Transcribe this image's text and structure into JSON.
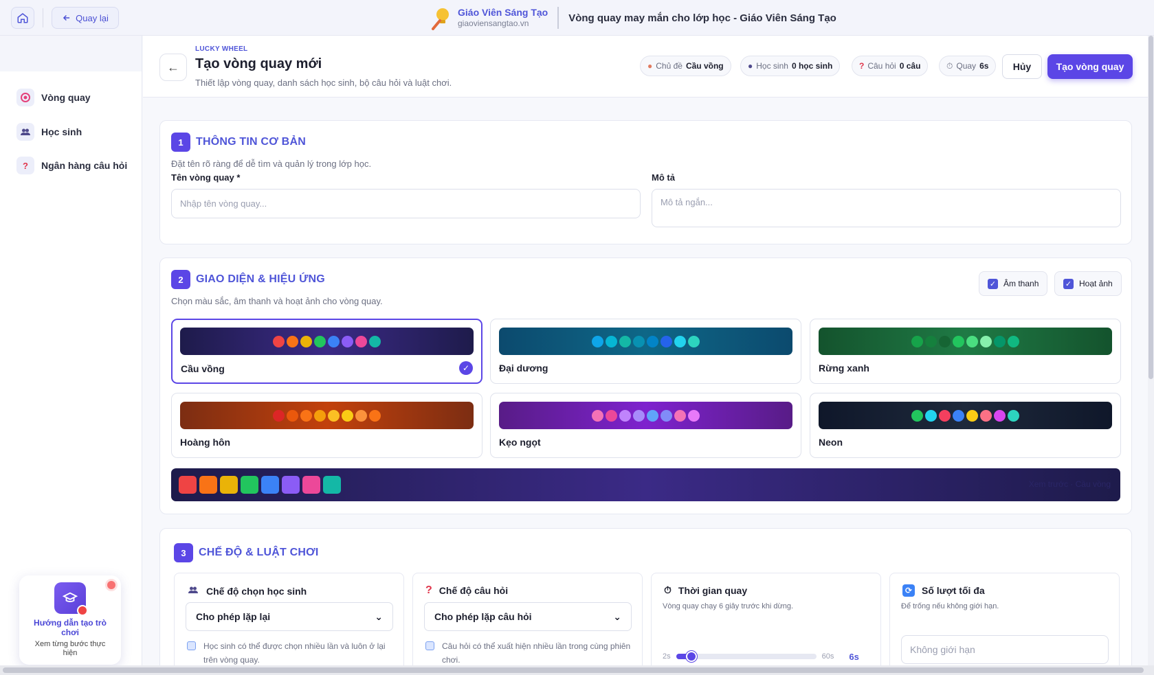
{
  "topbar": {
    "back_label": "Quay lại",
    "brand_name": "Giáo Viên Sáng Tạo",
    "brand_url": "giaoviensangtao.vn",
    "page_title": "Vòng quay may mắn cho lớp học - Giáo Viên Sáng Tạo"
  },
  "sidebar": {
    "items": [
      {
        "label": "Vòng quay",
        "icon": "target-icon"
      },
      {
        "label": "Học sinh",
        "icon": "users-icon"
      },
      {
        "label": "Ngân hàng câu hỏi",
        "icon": "question-icon"
      }
    ]
  },
  "guide": {
    "title": "Hướng dẫn tạo trò chơi",
    "subtitle": "Xem từng bước thực hiện"
  },
  "header": {
    "kicker": "LUCKY WHEEL",
    "title": "Tạo vòng quay mới",
    "subtitle": "Thiết lập vòng quay, danh sách học sinh, bộ câu hỏi và luật chơi.",
    "chips": [
      {
        "label": "Chủ đề",
        "value": "Cầu vồng"
      },
      {
        "label": "Học sinh",
        "value": "0 học sinh"
      },
      {
        "label": "Câu hỏi",
        "value": "0 câu"
      },
      {
        "label": "Quay",
        "value": "6s"
      }
    ],
    "cancel_label": "Hủy",
    "create_label": "Tạo vòng quay"
  },
  "section1": {
    "number": "1",
    "title": "THÔNG TIN CƠ BẢN",
    "desc": "Đặt tên rõ ràng để dễ tìm và quản lý trong lớp học.",
    "name_label": "Tên vòng quay *",
    "name_placeholder": "Nhập tên vòng quay...",
    "desc_label": "Mô tả",
    "desc_placeholder": "Mô tả ngắn..."
  },
  "section2": {
    "number": "2",
    "title": "GIAO DIỆN & HIỆU ỨNG",
    "desc": "Chọn màu sắc, âm thanh và hoạt ảnh cho vòng quay.",
    "sound_label": "Âm thanh",
    "sound_checked": true,
    "anim_label": "Hoạt ảnh",
    "anim_checked": true,
    "themes": [
      {
        "name": "Cầu vồng",
        "selected": true,
        "bg": "linear-gradient(90deg,#1e1b4b,#3b2a86 50%,#1e1b4b)",
        "colors": [
          "#ef4444",
          "#f97316",
          "#eab308",
          "#22c55e",
          "#3b82f6",
          "#8b5cf6",
          "#ec4899",
          "#14b8a6"
        ]
      },
      {
        "name": "Đại dương",
        "selected": false,
        "bg": "linear-gradient(90deg,#0c4a6e,#0e6787 50%,#0c4a6e)",
        "colors": [
          "#0ea5e9",
          "#06b6d4",
          "#14b8a6",
          "#0891b2",
          "#0284c7",
          "#2563eb",
          "#22d3ee",
          "#2dd4bf"
        ]
      },
      {
        "name": "Rừng xanh",
        "selected": false,
        "bg": "linear-gradient(90deg,#14532d,#1f7a45 50%,#14532d)",
        "colors": [
          "#16a34a",
          "#15803d",
          "#166534",
          "#22c55e",
          "#4ade80",
          "#86efac",
          "#059669",
          "#10b981"
        ]
      },
      {
        "name": "Hoàng hôn",
        "selected": false,
        "bg": "linear-gradient(90deg,#7c2d12,#c2410c 50%,#7c2d12)",
        "colors": [
          "#dc2626",
          "#ea580c",
          "#f97316",
          "#f59e0b",
          "#fbbf24",
          "#facc15",
          "#fb923c",
          "#f97316"
        ]
      },
      {
        "name": "Kẹo ngọt",
        "selected": false,
        "bg": "linear-gradient(90deg,#581c87,#7e22ce 50%,#581c87)",
        "colors": [
          "#f472b6",
          "#ec4899",
          "#c084fc",
          "#a78bfa",
          "#60a5fa",
          "#818cf8",
          "#f472b6",
          "#e879f9"
        ]
      },
      {
        "name": "Neon",
        "selected": false,
        "bg": "linear-gradient(90deg,#0f172a,#1e293b 50%,#0f172a)",
        "colors": [
          "#22c55e",
          "#22d3ee",
          "#f43f5e",
          "#3b82f6",
          "#facc15",
          "#fb7185",
          "#d946ef",
          "#2dd4bf"
        ]
      }
    ],
    "preview_colors": [
      "#ef4444",
      "#f97316",
      "#eab308",
      "#22c55e",
      "#3b82f6",
      "#8b5cf6",
      "#ec4899",
      "#14b8a6"
    ],
    "preview_note": "Xem trước · Cầu vồng"
  },
  "section3": {
    "number": "3",
    "title": "CHẾ ĐỘ & LUẬT CHƠI",
    "student_mode": {
      "title": "Chế độ chọn học sinh",
      "selected": "Cho phép lặp lại",
      "note": "Học sinh có thể được chọn nhiều lần và luôn ở lại trên vòng quay."
    },
    "question_mode": {
      "title": "Chế độ câu hỏi",
      "selected": "Cho phép lặp câu hỏi",
      "note": "Câu hỏi có thể xuất hiện nhiều lần trong cùng phiên chơi."
    },
    "spin_time": {
      "title": "Thời gian quay",
      "desc": "Vòng quay chạy 6 giây trước khi dừng.",
      "min_label": "2s",
      "max_label": "60s",
      "value_label": "6s",
      "value": 6,
      "min": 2,
      "max": 60
    },
    "max_turns": {
      "title": "Số lượt tối đa",
      "desc": "Để trống nếu không giới hạn.",
      "placeholder": "Không giới hạn"
    }
  }
}
